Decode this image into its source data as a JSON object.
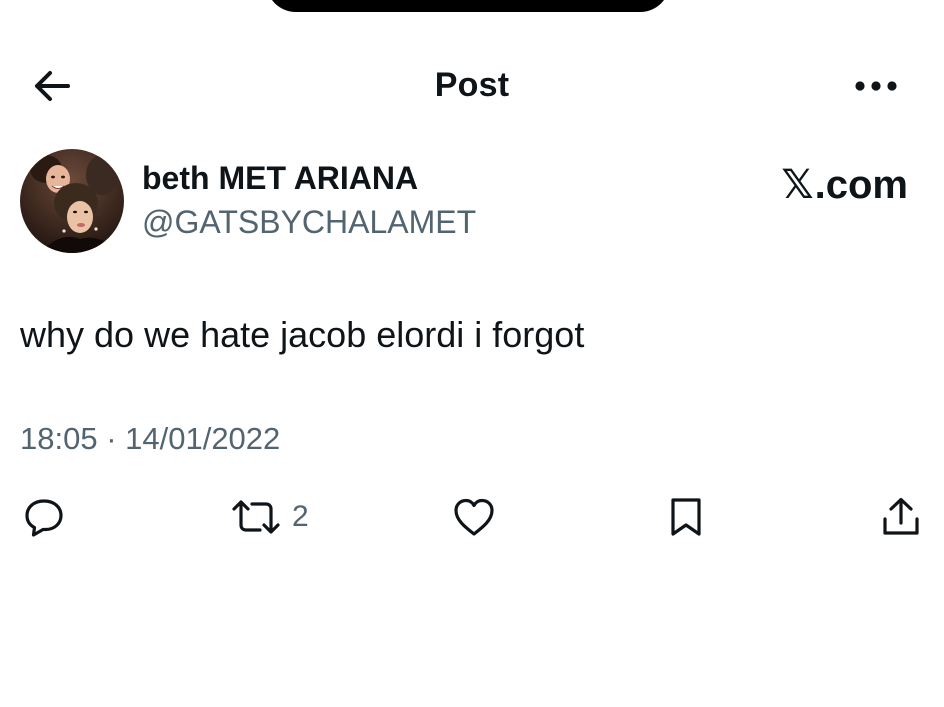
{
  "header": {
    "title": "Post",
    "back_icon": "arrow-left-icon",
    "more_icon": "more-horizontal-icon"
  },
  "author": {
    "display_name": "beth MET ARIANA",
    "handle": "@GATSBYCHALAMET"
  },
  "watermark": {
    "mark": "𝕏",
    "suffix": ".com"
  },
  "tweet": {
    "text": "why do we hate jacob elordi i forgot",
    "timestamp": "18:05 · 14/01/2022"
  },
  "actions": {
    "reply_icon": "reply-icon",
    "repost_icon": "repost-icon",
    "repost_count": "2",
    "like_icon": "heart-icon",
    "bookmark_icon": "bookmark-icon",
    "share_icon": "share-icon"
  },
  "colors": {
    "text_primary": "#0f1419",
    "text_secondary": "#536471",
    "background": "#ffffff"
  }
}
